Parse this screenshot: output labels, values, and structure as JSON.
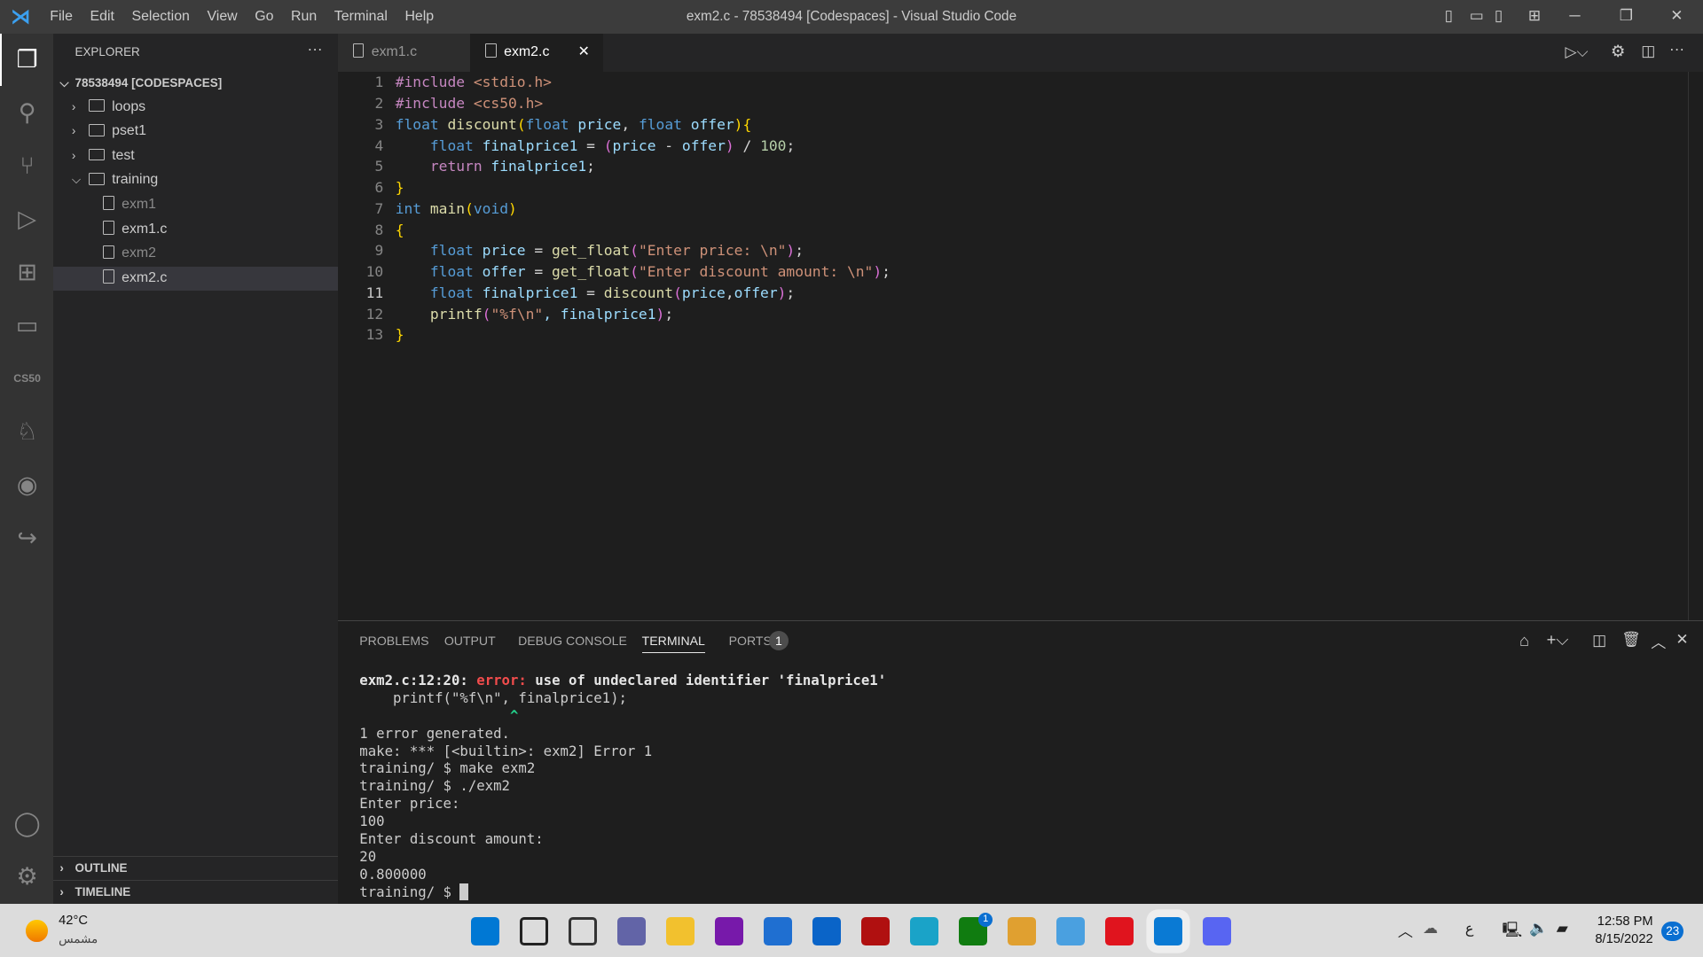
{
  "window": {
    "title": "exm2.c - 78538494 [Codespaces] - Visual Studio Code",
    "menu": [
      "File",
      "Edit",
      "Selection",
      "View",
      "Go",
      "Run",
      "Terminal",
      "Help"
    ]
  },
  "activity_bar": {
    "items": [
      "explorer",
      "search",
      "source-control",
      "run-debug",
      "extensions",
      "remote-explorer",
      "cs50",
      "ducky",
      "github",
      "live-share",
      "accounts",
      "settings"
    ],
    "cs50_label": "CS50"
  },
  "sidebar": {
    "title": "EXPLORER",
    "root": "78538494 [CODESPACES]",
    "items": [
      {
        "label": "loops",
        "type": "folder",
        "expanded": false
      },
      {
        "label": "pset1",
        "type": "folder",
        "expanded": false
      },
      {
        "label": "test",
        "type": "folder",
        "expanded": false
      },
      {
        "label": "training",
        "type": "folder",
        "expanded": true
      },
      {
        "label": "exm1",
        "type": "file",
        "dim": true
      },
      {
        "label": "exm1.c",
        "type": "file"
      },
      {
        "label": "exm2",
        "type": "file",
        "dim": true
      },
      {
        "label": "exm2.c",
        "type": "file",
        "selected": true
      }
    ],
    "outline": "OUTLINE",
    "timeline": "TIMELINE"
  },
  "tabs": [
    {
      "label": "exm1.c",
      "active": false
    },
    {
      "label": "exm2.c",
      "active": true
    }
  ],
  "editor": {
    "current_line": 11,
    "lines": [
      [
        [
          "#include",
          "pp"
        ],
        [
          " <stdio.h>",
          "str"
        ]
      ],
      [
        [
          "#include",
          "pp"
        ],
        [
          " <cs50.h>",
          "str"
        ]
      ],
      [
        [
          "float",
          "kw"
        ],
        [
          " ",
          "pl"
        ],
        [
          "discount",
          "fn"
        ],
        [
          "(",
          "br1"
        ],
        [
          "float",
          "kw"
        ],
        [
          " price",
          "var"
        ],
        [
          ", ",
          "pl"
        ],
        [
          "float",
          "kw"
        ],
        [
          " offer",
          "var"
        ],
        [
          ")",
          "br1"
        ],
        [
          "{",
          "br1"
        ]
      ],
      [
        [
          "    ",
          "pl"
        ],
        [
          "float",
          "kw"
        ],
        [
          " finalprice1",
          "var"
        ],
        [
          " = ",
          "pl"
        ],
        [
          "(",
          "br2"
        ],
        [
          "price",
          "var"
        ],
        [
          " - ",
          "pl"
        ],
        [
          "offer",
          "var"
        ],
        [
          ")",
          "br2"
        ],
        [
          " / ",
          "pl"
        ],
        [
          "100",
          "num"
        ],
        [
          ";",
          "pl"
        ]
      ],
      [
        [
          "    ",
          "pl"
        ],
        [
          "return",
          "pp"
        ],
        [
          " finalprice1",
          "var"
        ],
        [
          ";",
          "pl"
        ]
      ],
      [
        [
          "}",
          "br1"
        ]
      ],
      [
        [
          "int",
          "kw"
        ],
        [
          " ",
          "pl"
        ],
        [
          "main",
          "fn"
        ],
        [
          "(",
          "br1"
        ],
        [
          "void",
          "kw"
        ],
        [
          ")",
          "br1"
        ]
      ],
      [
        [
          "{",
          "br1"
        ]
      ],
      [
        [
          "    ",
          "pl"
        ],
        [
          "float",
          "kw"
        ],
        [
          " price",
          "var"
        ],
        [
          " = ",
          "pl"
        ],
        [
          "get_float",
          "fn"
        ],
        [
          "(",
          "br2"
        ],
        [
          "\"Enter price: \\n\"",
          "str"
        ],
        [
          ")",
          "br2"
        ],
        [
          ";",
          "pl"
        ]
      ],
      [
        [
          "    ",
          "pl"
        ],
        [
          "float",
          "kw"
        ],
        [
          " offer",
          "var"
        ],
        [
          " = ",
          "pl"
        ],
        [
          "get_float",
          "fn"
        ],
        [
          "(",
          "br2"
        ],
        [
          "\"Enter discount amount: \\n\"",
          "str"
        ],
        [
          ")",
          "br2"
        ],
        [
          ";",
          "pl"
        ]
      ],
      [
        [
          "    ",
          "pl"
        ],
        [
          "float",
          "kw"
        ],
        [
          " finalprice1",
          "var"
        ],
        [
          " = ",
          "pl"
        ],
        [
          "discount",
          "fn"
        ],
        [
          "(",
          "br2"
        ],
        [
          "price",
          "var"
        ],
        [
          ",",
          "pl"
        ],
        [
          "offer",
          "var"
        ],
        [
          ")",
          "br2"
        ],
        [
          ";",
          "pl"
        ]
      ],
      [
        [
          "    ",
          "pl"
        ],
        [
          "printf",
          "fn"
        ],
        [
          "(",
          "br2"
        ],
        [
          "\"%f\\n\"",
          "str"
        ],
        [
          ", finalprice1",
          "var"
        ],
        [
          ")",
          "br2"
        ],
        [
          ";",
          "pl"
        ]
      ],
      [
        [
          "}",
          "br1"
        ]
      ]
    ]
  },
  "panel": {
    "tabs": [
      "PROBLEMS",
      "OUTPUT",
      "DEBUG CONSOLE",
      "TERMINAL",
      "PORTS"
    ],
    "active": "TERMINAL",
    "ports_badge": "1",
    "terminal": {
      "error_loc": "exm2.c:12:20: ",
      "error_word": "error:",
      "error_msg": " use of undeclared identifier 'finalprice1'",
      "lines": [
        "    printf(\"%f\\n\", finalprice1);",
        "",
        "1 error generated.",
        "make: *** [<builtin>: exm2] Error 1",
        "training/ $ make exm2",
        "training/ $ ./exm2",
        "Enter price:",
        "100",
        "Enter discount amount:",
        "20",
        "0.800000"
      ],
      "caret": "                  ^",
      "prompt": "training/ $ "
    }
  },
  "taskbar": {
    "weather_temp": "42°C",
    "weather_desc": "مشمس",
    "lang": "ع",
    "time": "12:58 PM",
    "date": "8/15/2022",
    "notifications": "23",
    "teams_badge": "1",
    "apps": [
      {
        "name": "start",
        "color": "#0078d4"
      },
      {
        "name": "search",
        "color": "#222"
      },
      {
        "name": "task-view",
        "color": "#333"
      },
      {
        "name": "chat",
        "color": "#6264a7"
      },
      {
        "name": "file-explorer",
        "color": "#f2c12e"
      },
      {
        "name": "onenote",
        "color": "#7719aa"
      },
      {
        "name": "store",
        "color": "#1f6fd1"
      },
      {
        "name": "mail",
        "color": "#0a64c8"
      },
      {
        "name": "app-red",
        "color": "#b01010"
      },
      {
        "name": "edge",
        "color": "#1aa3c8"
      },
      {
        "name": "xbox",
        "color": "#107c10"
      },
      {
        "name": "drop",
        "color": "#e0a030"
      },
      {
        "name": "control-panel",
        "color": "#4aa0e0"
      },
      {
        "name": "opera",
        "color": "#e0141e"
      },
      {
        "name": "vscode",
        "color": "#0a7ad4"
      },
      {
        "name": "discord",
        "color": "#5865f2"
      }
    ]
  },
  "colors": {
    "accent": "#007acc",
    "error": "#f14c4c"
  }
}
